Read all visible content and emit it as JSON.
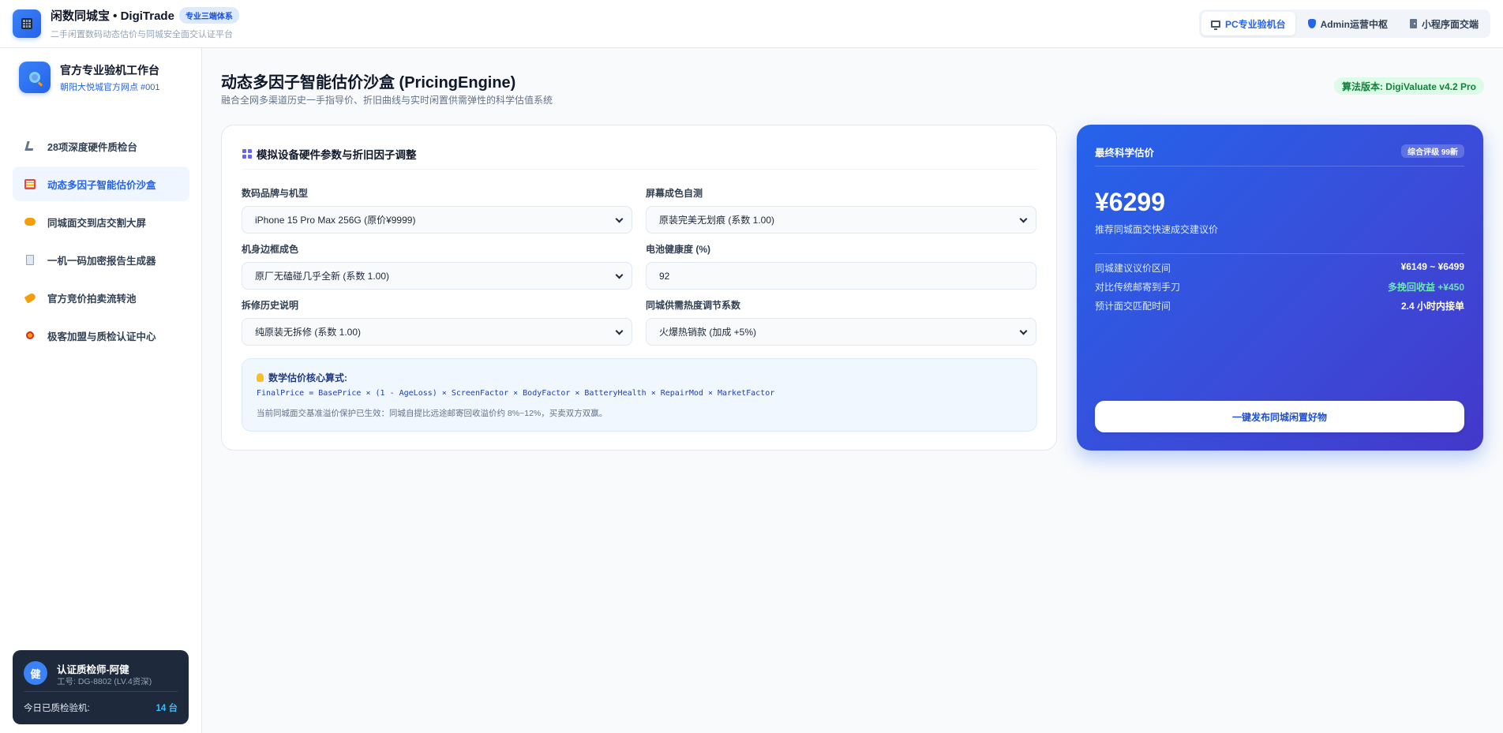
{
  "header": {
    "brand_title": "闲数同城宝 • DigiTrade",
    "brand_badge": "专业三端体系",
    "brand_subtitle": "二手闲置数码动态估价与同城安全面交认证平台",
    "modes": [
      {
        "label": "PC专业验机台",
        "icon": "monitor-icon",
        "active": true
      },
      {
        "label": "Admin运营中枢",
        "icon": "shield-icon",
        "active": false
      },
      {
        "label": "小程序面交端",
        "icon": "door-icon",
        "active": false
      }
    ]
  },
  "sidebar": {
    "workspace_title": "官方专业验机工作台",
    "workspace_subtitle": "朝阳大悦城官方网点 #001",
    "items": [
      {
        "label": "28项深度硬件质检台",
        "icon": "microscope-icon"
      },
      {
        "label": "动态多因子智能估价沙盒",
        "icon": "ledger-icon",
        "active": true
      },
      {
        "label": "同城面交到店交割大屏",
        "icon": "handshake-icon"
      },
      {
        "label": "一机一码加密报告生成器",
        "icon": "document-icon"
      },
      {
        "label": "官方竞价拍卖流转池",
        "icon": "tag-icon"
      },
      {
        "label": "极客加盟与质检认证中心",
        "icon": "medal-icon"
      }
    ],
    "user": {
      "avatar_char": "健",
      "name": "认证质检师-阿健",
      "id": "工号: DG-8802 (LV.4资深)",
      "count_label": "今日已质检验机:",
      "count_value": "14 台"
    }
  },
  "main": {
    "title": "动态多因子智能估价沙盒 (PricingEngine)",
    "subtitle": "融合全网多渠道历史一手指导价、折旧曲线与实时闲置供需弹性的科学估值系统",
    "algo_badge": "算法版本: DigiValuate v4.2 Pro",
    "param_card": {
      "title": "模拟设备硬件参数与折旧因子调整",
      "fields": {
        "model": {
          "label": "数码品牌与机型",
          "value": "iPhone 15 Pro Max 256G (原价¥9999)"
        },
        "screen": {
          "label": "屏幕成色自测",
          "value": "原装完美无划痕 (系数 1.00)"
        },
        "body": {
          "label": "机身边框成色",
          "value": "原厂无磕碰几乎全新 (系数 1.00)"
        },
        "battery": {
          "label": "电池健康度 (%)",
          "value": "92"
        },
        "repair": {
          "label": "拆修历史说明",
          "value": "纯原装无拆修 (系数 1.00)"
        },
        "market": {
          "label": "同城供需热度调节系数",
          "value": "火爆热销款 (加成 +5%)"
        }
      },
      "formula": {
        "title": "数学估价核心算式:",
        "code": "FinalPrice = BasePrice × (1 - AgeLoss) × ScreenFactor × BodyFactor × BatteryHealth × RepairMod × MarketFactor",
        "note": "当前同城面交基准溢价保护已生效：同城自提比远途邮寄回收溢价约 8%~12%，买卖双方双赢。"
      }
    },
    "price_card": {
      "title": "最终科学估价",
      "rating": "综合评级 99新",
      "price": "¥6299",
      "hint": "推荐同城面交快速成交建议价",
      "rows": [
        {
          "key": "同城建议议价区间",
          "value": "¥6149 ~ ¥6499"
        },
        {
          "key": "对比传统邮寄到手刀",
          "value": "多挽回收益 +¥450"
        },
        {
          "key": "预计面交匹配时间",
          "value": "2.4 小时内接单"
        }
      ],
      "button": "一键发布同城闲置好物"
    }
  }
}
